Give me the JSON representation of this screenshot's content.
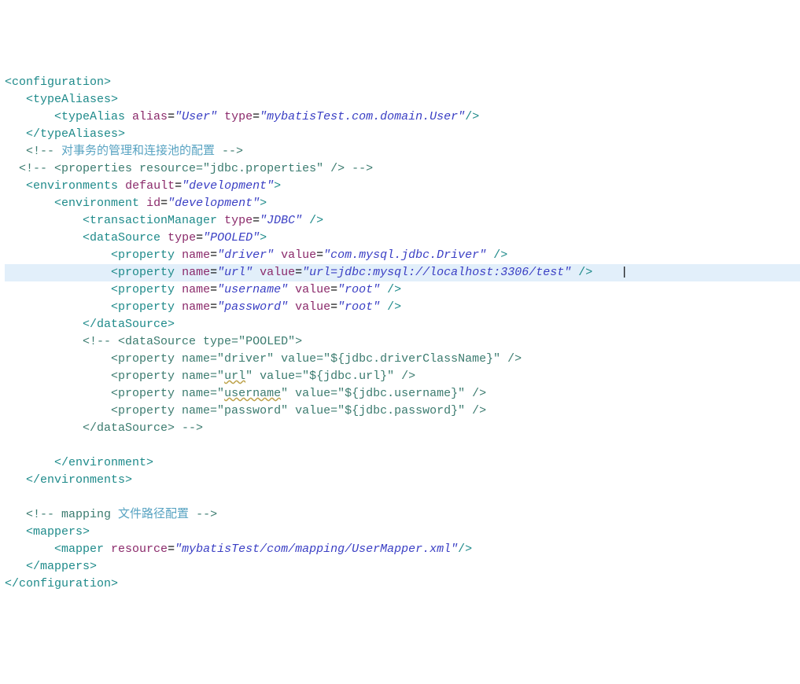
{
  "lines": {
    "l1": {
      "t1": "<configuration>"
    },
    "l2": {
      "t1": "<typeAliases>"
    },
    "l3": {
      "t1": "<typeAlias",
      "a1": "alias",
      "e1": "=",
      "v1": "\"User\"",
      "a2": "type",
      "e2": "=",
      "v2": "\"mybatisTest.com.domain.User\"",
      "t2": "/>"
    },
    "l4": {
      "t1": "</typeAliases>"
    },
    "l5": {
      "c1": "<!--",
      "cj": " 对事务的管理和连接池的配置 ",
      "c2": "-->"
    },
    "l6": {
      "c1": "<!-- <properties resource=\"jdbc.properties\" /> -->"
    },
    "l7": {
      "t1": "<environments",
      "a1": "default",
      "e1": "=",
      "v1": "\"development\"",
      "t2": ">"
    },
    "l8": {
      "t1": "<environment",
      "a1": "id",
      "e1": "=",
      "v1": "\"development\"",
      "t2": ">"
    },
    "l9": {
      "t1": "<transactionManager",
      "a1": "type",
      "e1": "=",
      "v1": "\"JDBC\"",
      "t2": " />"
    },
    "l10": {
      "t1": "<dataSource",
      "a1": "type",
      "e1": "=",
      "v1": "\"POOLED\"",
      "t2": ">"
    },
    "l11": {
      "t1": "<property",
      "a1": "name",
      "e1": "=",
      "v1": "\"driver\"",
      "a2": "value",
      "e2": "=",
      "v2": "\"com.mysql.jdbc.Driver\"",
      "t2": " />"
    },
    "l12": {
      "t1": "<property",
      "a1": "name",
      "e1": "=",
      "v1": "\"url\"",
      "a2": "value",
      "e2": "=",
      "v2": "\"url=jdbc:mysql://localhost:3306/test\"",
      "t2": " />"
    },
    "l13": {
      "t1": "<property",
      "a1": "name",
      "e1": "=",
      "v1": "\"username\"",
      "a2": "value",
      "e2": "=",
      "v2": "\"root\"",
      "t2": " />"
    },
    "l14": {
      "t1": "<property",
      "a1": "name",
      "e1": "=",
      "v1": "\"password\"",
      "a2": "value",
      "e2": "=",
      "v2": "\"root\"",
      "t2": " />"
    },
    "l15": {
      "t1": "</dataSource>"
    },
    "l16": {
      "c1": "<!-- <dataSource type=\"POOLED\">"
    },
    "l17": {
      "c1": " <property name=\"driver\" value=\"${jdbc.driverClassName}\" />"
    },
    "l18a": {
      "c1": " <property name=\""
    },
    "l18b": {
      "u": "url"
    },
    "l18c": {
      "c2": "\" value=\"${jdbc.url}\" />"
    },
    "l19a": {
      "c1": " <property name=\""
    },
    "l19b": {
      "u": "username"
    },
    "l19c": {
      "c2": "\" value=\"${jdbc.username}\" />"
    },
    "l20": {
      "c1": " <property name=\"password\" value=\"${jdbc.password}\" />"
    },
    "l21": {
      "c1": " </dataSource> -->"
    },
    "l22": {
      "t1": "</environment>"
    },
    "l23": {
      "t1": "</environments>"
    },
    "l24a": {
      "c1": "<!-- mapping "
    },
    "l24b": {
      "cj": "文件路径配置 "
    },
    "l24c": {
      "c2": "-->"
    },
    "l25": {
      "t1": "<mappers>"
    },
    "l26": {
      "t1": "<mapper",
      "a1": "resource",
      "e1": "=",
      "v1": "\"mybatisTest/com/mapping/UserMapper.xml\"",
      "t2": "/>"
    },
    "l27": {
      "t1": "</mappers>"
    },
    "l28": {
      "t1": "</configuration>"
    }
  }
}
